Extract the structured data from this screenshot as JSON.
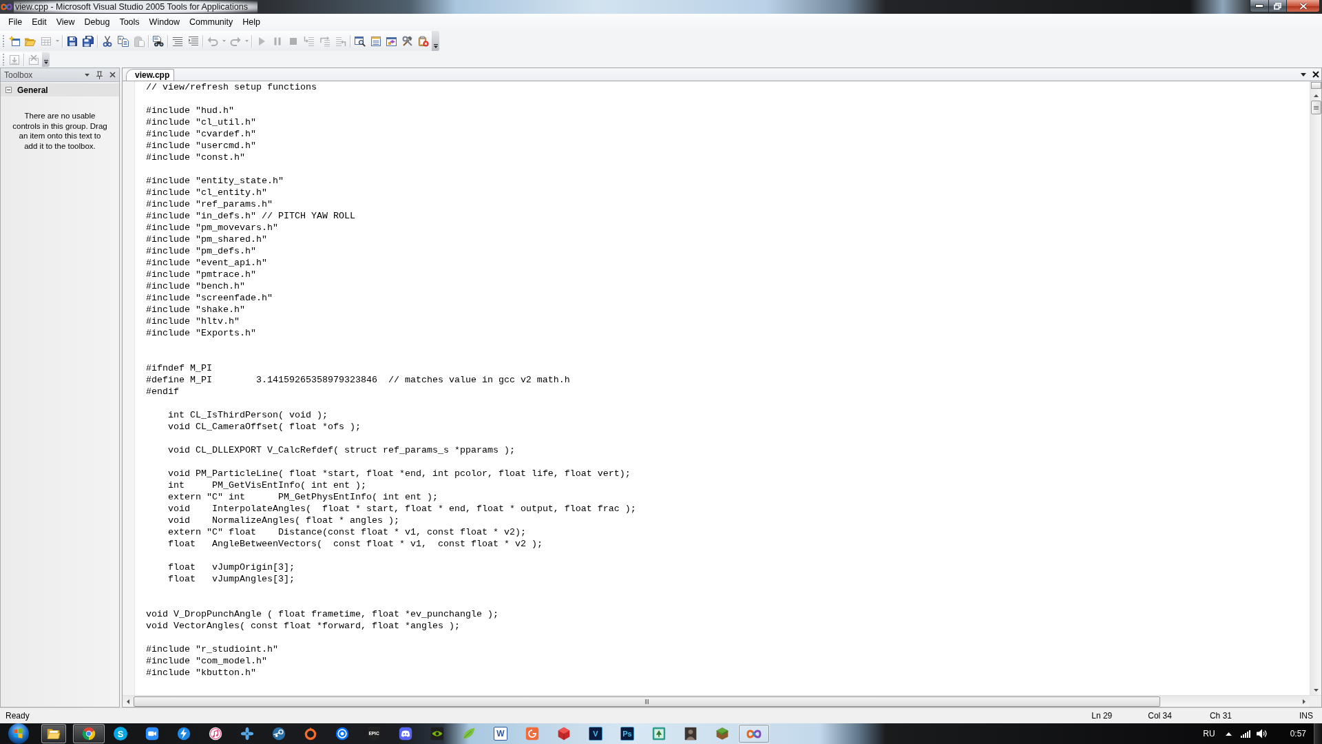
{
  "window": {
    "title": "view.cpp - Microsoft Visual Studio 2005 Tools for Applications"
  },
  "menu": [
    "File",
    "Edit",
    "View",
    "Debug",
    "Tools",
    "Window",
    "Community",
    "Help"
  ],
  "toolbars": [
    {
      "groups": [
        [
          {
            "kind": "newproject",
            "disabled": false,
            "dropdown": false
          },
          {
            "kind": "open",
            "disabled": false,
            "dropdown": false
          },
          {
            "kind": "additem",
            "disabled": true,
            "dropdown": true
          }
        ],
        [
          {
            "kind": "save",
            "disabled": false,
            "dropdown": false
          },
          {
            "kind": "saveall",
            "disabled": false,
            "dropdown": false
          }
        ],
        [
          {
            "kind": "cut",
            "disabled": false,
            "dropdown": false
          },
          {
            "kind": "copy",
            "disabled": false,
            "dropdown": false
          },
          {
            "kind": "paste",
            "disabled": true,
            "dropdown": false
          }
        ],
        [
          {
            "kind": "find",
            "disabled": false,
            "dropdown": false
          }
        ],
        [
          {
            "kind": "comment",
            "disabled": false,
            "dropdown": false
          },
          {
            "kind": "uncomment",
            "disabled": false,
            "dropdown": false
          }
        ],
        [
          {
            "kind": "undo",
            "disabled": true,
            "dropdown": true
          },
          {
            "kind": "redo",
            "disabled": true,
            "dropdown": true
          }
        ],
        [
          {
            "kind": "start",
            "disabled": true,
            "dropdown": false
          },
          {
            "kind": "pause",
            "disabled": true,
            "dropdown": false
          },
          {
            "kind": "stop",
            "disabled": true,
            "dropdown": false
          },
          {
            "kind": "stepinto",
            "disabled": true,
            "dropdown": false
          },
          {
            "kind": "stepover",
            "disabled": true,
            "dropdown": false
          },
          {
            "kind": "stepout",
            "disabled": true,
            "dropdown": false
          }
        ],
        [
          {
            "kind": "explorer",
            "disabled": false,
            "dropdown": false
          },
          {
            "kind": "properties",
            "disabled": false,
            "dropdown": false
          },
          {
            "kind": "objectbrowser",
            "disabled": false,
            "dropdown": false
          },
          {
            "kind": "toolbox",
            "disabled": false,
            "dropdown": false
          },
          {
            "kind": "exceptions",
            "disabled": false,
            "dropdown": false
          }
        ]
      ]
    },
    {
      "groups": [
        [
          {
            "kind": "import",
            "disabled": true,
            "dropdown": false
          }
        ],
        [
          {
            "kind": "remove",
            "disabled": true,
            "dropdown": false
          }
        ]
      ]
    }
  ],
  "toolbox": {
    "title": "Toolbox",
    "group": {
      "label": "General",
      "expanded": true
    },
    "message": "There are no usable controls in this group. Drag an item onto this text to add it to the toolbox."
  },
  "editor": {
    "tabs": [
      {
        "label": "view.cpp",
        "selected": true
      }
    ],
    "lines": [
      {
        "kind": "code",
        "text": "// view/refresh setup functions"
      },
      {
        "kind": "blank"
      },
      {
        "kind": "code",
        "text": "#include \"hud.h\""
      },
      {
        "kind": "code",
        "text": "#include \"cl_util.h\""
      },
      {
        "kind": "code",
        "text": "#include \"cvardef.h\""
      },
      {
        "kind": "code",
        "text": "#include \"usercmd.h\""
      },
      {
        "kind": "code",
        "text": "#include \"const.h\""
      },
      {
        "kind": "blank"
      },
      {
        "kind": "code",
        "text": "#include \"entity_state.h\""
      },
      {
        "kind": "code",
        "text": "#include \"cl_entity.h\""
      },
      {
        "kind": "code",
        "text": "#include \"ref_params.h\""
      },
      {
        "kind": "code",
        "text": "#include \"in_defs.h\" // PITCH YAW ROLL"
      },
      {
        "kind": "code",
        "text": "#include \"pm_movevars.h\""
      },
      {
        "kind": "code",
        "text": "#include \"pm_shared.h\""
      },
      {
        "kind": "code",
        "text": "#include \"pm_defs.h\""
      },
      {
        "kind": "code",
        "text": "#include \"event_api.h\""
      },
      {
        "kind": "code",
        "text": "#include \"pmtrace.h\""
      },
      {
        "kind": "code",
        "text": "#include \"bench.h\""
      },
      {
        "kind": "code",
        "text": "#include \"screenfade.h\""
      },
      {
        "kind": "code",
        "text": "#include \"shake.h\""
      },
      {
        "kind": "code",
        "text": "#include \"hltv.h\""
      },
      {
        "kind": "code",
        "text": "#include \"Exports.h\""
      },
      {
        "kind": "blank"
      },
      {
        "kind": "blank"
      },
      {
        "kind": "code",
        "text": "#ifndef M_PI"
      },
      {
        "kind": "code",
        "text": "#define M_PI        3.14159265358979323846  // matches value in gcc v2 math.h"
      },
      {
        "kind": "code",
        "text": "#endif"
      },
      {
        "kind": "blank"
      },
      {
        "kind": "code",
        "text": "    int CL_IsThirdPerson( void );"
      },
      {
        "kind": "code",
        "text": "    void CL_CameraOffset( float *ofs );"
      },
      {
        "kind": "blank"
      },
      {
        "kind": "code",
        "text": "    void CL_DLLEXPORT V_CalcRefdef( struct ref_params_s *pparams );"
      },
      {
        "kind": "blank"
      },
      {
        "kind": "code",
        "text": "    void PM_ParticleLine( float *start, float *end, int pcolor, float life, float vert);"
      },
      {
        "kind": "code",
        "text": "    int     PM_GetVisEntInfo( int ent );"
      },
      {
        "kind": "code",
        "text": "    extern \"C\" int      PM_GetPhysEntInfo( int ent );"
      },
      {
        "kind": "code",
        "text": "    void    InterpolateAngles(  float * start, float * end, float * output, float frac );"
      },
      {
        "kind": "code",
        "text": "    void    NormalizeAngles( float * angles );"
      },
      {
        "kind": "code",
        "text": "    extern \"C\" float    Distance(const float * v1, const float * v2);"
      },
      {
        "kind": "code",
        "text": "    float   AngleBetweenVectors(  const float * v1,  const float * v2 );"
      },
      {
        "kind": "blank"
      },
      {
        "kind": "code",
        "text": "    float   vJumpOrigin[3];"
      },
      {
        "kind": "code",
        "text": "    float   vJumpAngles[3];"
      },
      {
        "kind": "blank"
      },
      {
        "kind": "blank"
      },
      {
        "kind": "code",
        "text": "void V_DropPunchAngle ( float frametime, float *ev_punchangle );"
      },
      {
        "kind": "code",
        "text": "void VectorAngles( const float *forward, float *angles );"
      },
      {
        "kind": "blank"
      },
      {
        "kind": "code",
        "text": "#include \"r_studioint.h\""
      },
      {
        "kind": "code",
        "text": "#include \"com_model.h\""
      },
      {
        "kind": "code",
        "text": "#include \"kbutton.h\""
      }
    ]
  },
  "status_bar": {
    "message": "Ready",
    "line": "Ln 29",
    "column": "Col 34",
    "character": "Ch 31",
    "mode": "INS"
  },
  "taskbar": {
    "apps": [
      {
        "kind": "folder",
        "open": true
      },
      {
        "kind": "browser",
        "open": true
      },
      {
        "kind": "chat",
        "glyph": "S",
        "open": false
      },
      {
        "kind": "camera",
        "open": false
      },
      {
        "kind": "bolt",
        "open": false
      },
      {
        "kind": "music",
        "open": false
      },
      {
        "kind": "pinwheel",
        "open": false
      },
      {
        "kind": "linkage",
        "open": false
      },
      {
        "kind": "ring",
        "open": false
      },
      {
        "kind": "target",
        "open": false
      },
      {
        "kind": "shield",
        "glyph": "EPIC",
        "open": false
      },
      {
        "kind": "controller",
        "open": false
      },
      {
        "kind": "eye",
        "open": false
      },
      {
        "kind": "leaf",
        "open": false
      },
      {
        "kind": "page",
        "glyph": "W",
        "open": false
      },
      {
        "kind": "ringtile",
        "open": false
      },
      {
        "kind": "cube",
        "open": false
      },
      {
        "kind": "tile",
        "glyph": "V",
        "open": false
      },
      {
        "kind": "tile",
        "glyph": "Ps",
        "open": false
      },
      {
        "kind": "tree",
        "open": false
      },
      {
        "kind": "portrait",
        "open": false
      },
      {
        "kind": "block",
        "open": false
      },
      {
        "kind": "loop",
        "open": true
      }
    ],
    "language": "RU",
    "time": "0:57"
  }
}
